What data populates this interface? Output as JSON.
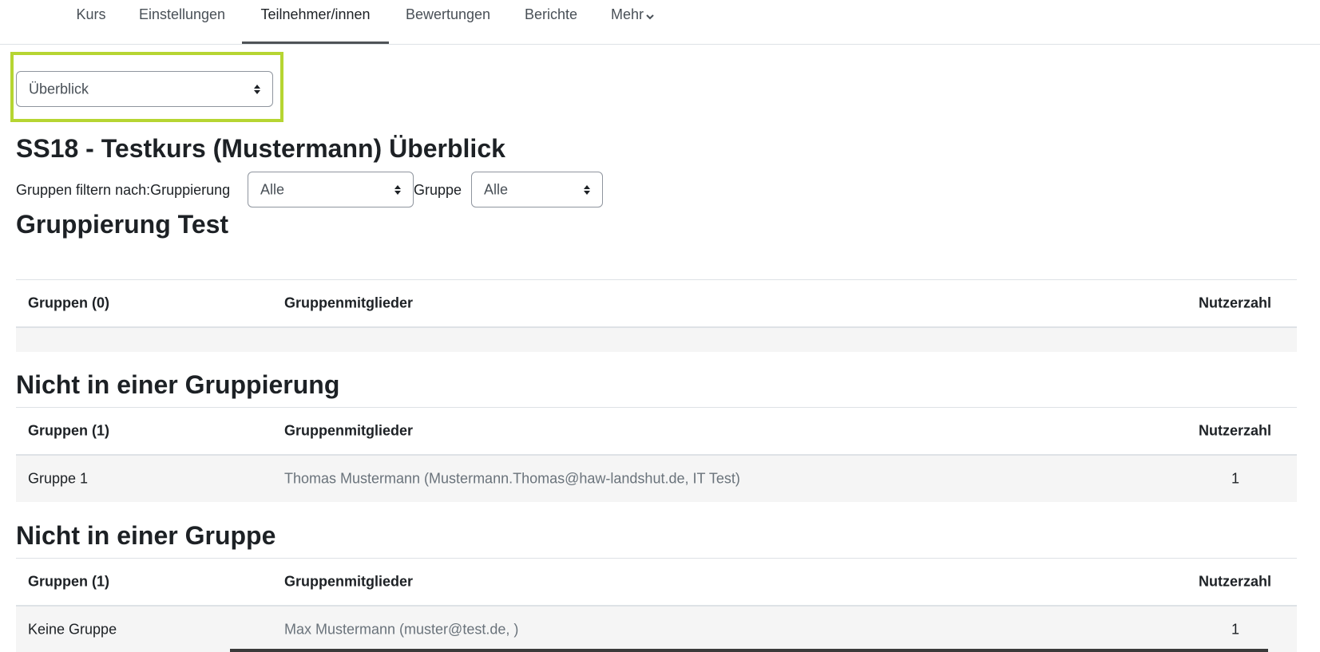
{
  "nav": {
    "tabs": [
      {
        "label": "Kurs"
      },
      {
        "label": "Einstellungen"
      },
      {
        "label": "Teilnehmer/innen"
      },
      {
        "label": "Bewertungen"
      },
      {
        "label": "Berichte"
      },
      {
        "label": "Mehr"
      }
    ],
    "active_tab": "Teilnehmer/innen"
  },
  "view_select": {
    "value": "Überblick"
  },
  "page_title": "SS18 - Testkurs (Mustermann) Überblick",
  "filter": {
    "label": "Gruppen filtern nach:Gruppierung",
    "grouping_value": "Alle",
    "group_label": "Gruppe",
    "group_value": "Alle"
  },
  "sections": [
    {
      "title": "Gruppierung Test",
      "headers": [
        "Gruppen (0)",
        "Gruppenmitglieder",
        "Nutzerzahl"
      ],
      "rows": []
    },
    {
      "title": "Nicht in einer Gruppierung",
      "headers": [
        "Gruppen (1)",
        "Gruppenmitglieder",
        "Nutzerzahl"
      ],
      "rows": [
        {
          "group": "Gruppe 1",
          "members": "Thomas Mustermann (Mustermann.Thomas@haw-landshut.de, IT Test)",
          "count": "1"
        }
      ]
    },
    {
      "title": "Nicht in einer Gruppe",
      "headers": [
        "Gruppen (1)",
        "Gruppenmitglieder",
        "Nutzerzahl"
      ],
      "rows": [
        {
          "group": "Keine Gruppe",
          "members": "Max Mustermann (muster@test.de, )",
          "count": "1"
        }
      ]
    }
  ],
  "colors": {
    "highlight": "#b6d532",
    "row_bg": "#f5f5f5",
    "border": "#dee2e6"
  }
}
